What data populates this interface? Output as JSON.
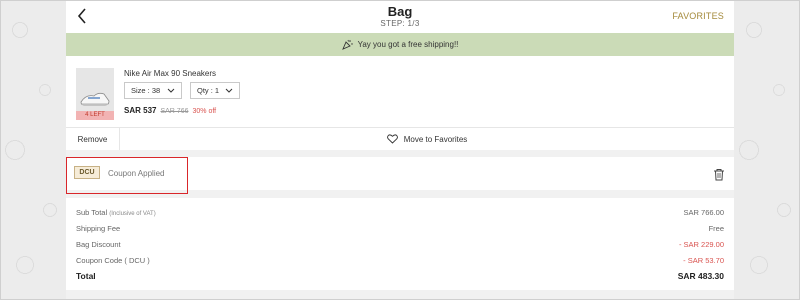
{
  "header": {
    "title": "Bag",
    "step": "STEP: 1/3",
    "favorites_label": "FAVORITES"
  },
  "shipping_banner": {
    "text": "Yay you got a free shipping!!"
  },
  "product": {
    "name": "Nike Air Max 90 Sneakers",
    "stock_badge": "4 LEFT",
    "size_label": "Size : 38",
    "qty_label": "Qty : 1",
    "price": "SAR 537",
    "original_price": "SAR 766",
    "discount": "30% off",
    "remove_label": "Remove",
    "move_to_favorites_label": "Move to Favorites"
  },
  "coupon": {
    "code": "DCU",
    "status": "Coupon Applied"
  },
  "summary": {
    "subtotal_label": "Sub Total",
    "subtotal_note": "(Inclusive of VAT)",
    "subtotal_value": "SAR 766.00",
    "shipping_label": "Shipping Fee",
    "shipping_value": "Free",
    "bag_discount_label": "Bag Discount",
    "bag_discount_value": "- SAR 229.00",
    "coupon_label": "Coupon Code ( DCU )",
    "coupon_value": "- SAR 53.70",
    "total_label": "Total",
    "total_value": "SAR 483.30"
  },
  "colors": {
    "accent_gold": "#a48a3b",
    "banner_green": "#cbdbb7",
    "discount_red": "#d9534f",
    "highlight_red": "#d9262a"
  }
}
